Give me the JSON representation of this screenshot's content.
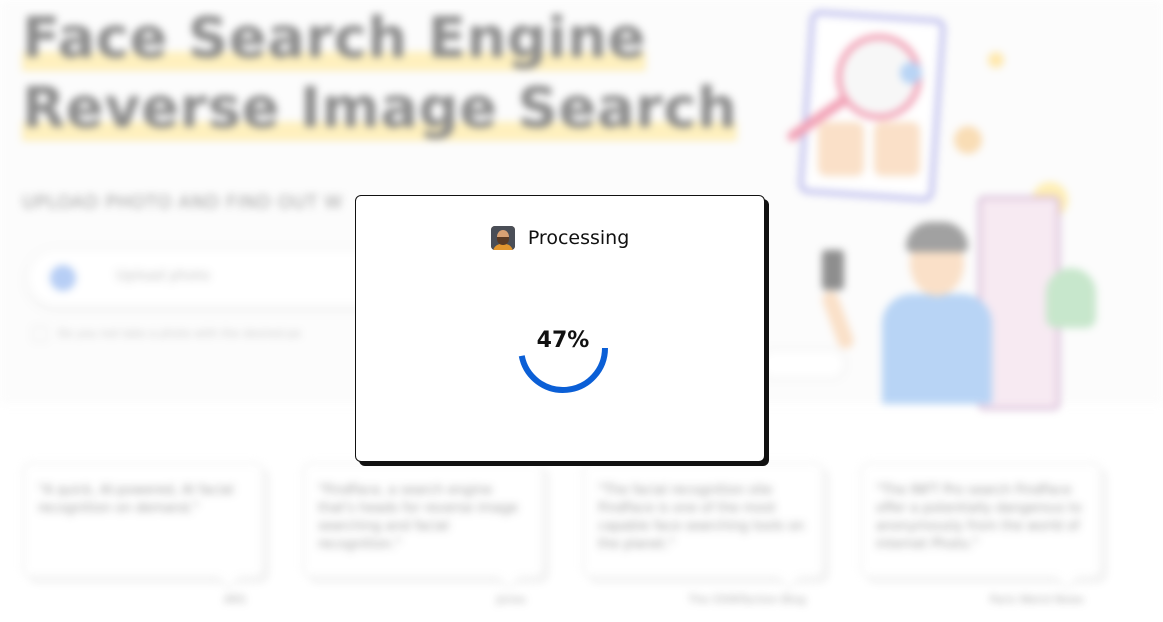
{
  "background": {
    "hero": {
      "title_line1": "Face Search Engine",
      "title_line2": "Reverse Image Search",
      "subtitle": "UPLOAD PHOTO AND FIND OUT W",
      "search_placeholder": "Upload photo",
      "hint": "Do you not take a photo with the desired pe"
    },
    "testimonials": [
      {
        "quote": "\"A quick, AI-powered, AI facial recognition on demand.\"",
        "by": "ARS"
      },
      {
        "quote": "\"FindFace, a search engine that's heads for reverse image searching and facial recognition.\"",
        "by": "Jones"
      },
      {
        "quote": "\"The facial recognition site FindFace is one of the most capable face searching tools on the planet.\"",
        "by": "The OSINTaction Blog"
      },
      {
        "quote": "\"The INFT Pro search FindFace offer a potentially dangerous to anonymously from the world of internet Photo.\"",
        "by": "Paris Weird News"
      }
    ]
  },
  "modal": {
    "title": "Processing",
    "progress": 47,
    "progress_text": "47%",
    "progress_color": "#0b5fd6",
    "avatar_icon": "user-avatar-icon"
  }
}
